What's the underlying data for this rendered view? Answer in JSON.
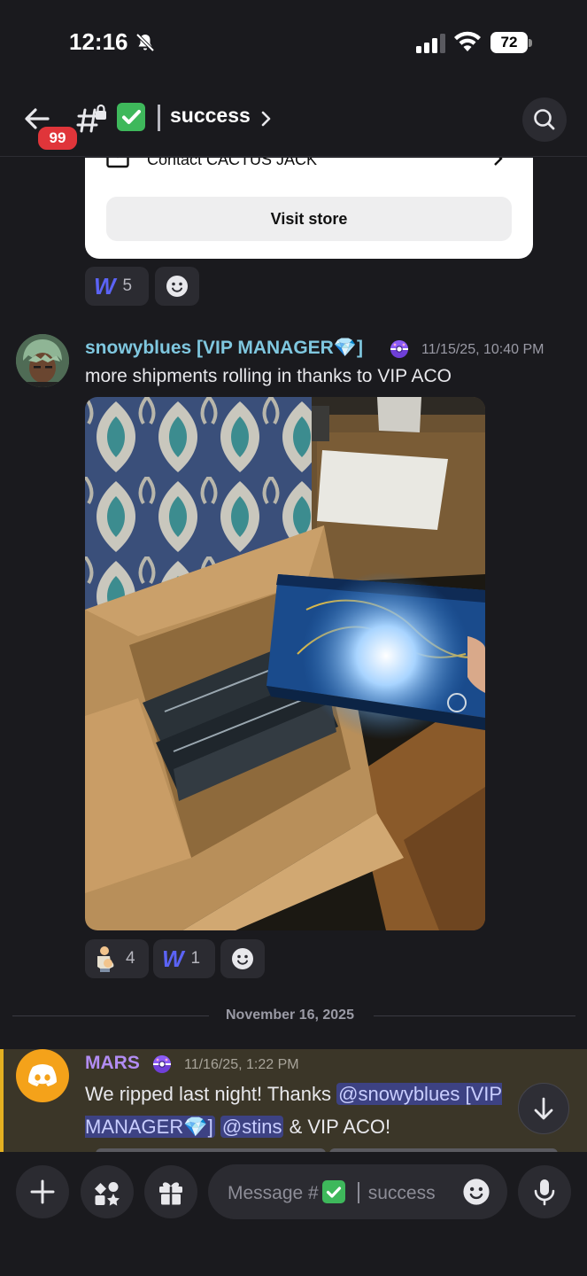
{
  "status_bar": {
    "time": "12:16",
    "battery": "72"
  },
  "header": {
    "unread_count": "99",
    "channel_name": "success"
  },
  "embed": {
    "contact_label": "Contact CACTUS JACK",
    "visit_button": "Visit store"
  },
  "reactions_top": [
    {
      "emoji": "w-logo",
      "count": "5"
    }
  ],
  "message1": {
    "author": "snowyblues [VIP MANAGER💎]",
    "timestamp": "11/15/25, 10:40 PM",
    "text": "more shipments rolling in thanks to VIP ACO"
  },
  "reactions_msg1": [
    {
      "emoji": "🤰",
      "count": "4"
    },
    {
      "emoji": "w-logo",
      "count": "1"
    }
  ],
  "date_separator": "November 16, 2025",
  "message2": {
    "author": "MARS",
    "timestamp": "11/16/25, 1:22 PM",
    "text_before": "We ripped last night! Thanks ",
    "mention1": "@snowyblues [VIP MANAGER💎]",
    "mention2": "@stins",
    "text_after": " & VIP ACO!"
  },
  "composer": {
    "placeholder_prefix": "Message #",
    "placeholder_channel": "success"
  },
  "colors": {
    "background": "#1a1a1e",
    "brand_w": "#5b63f5",
    "mention_highlight": "#3b3628",
    "mention_stripe": "#e3b021",
    "author1": "#7fc7df",
    "author2": "#b28cf2",
    "check_green": "#3eb85b",
    "badge_red": "#e0353a"
  }
}
